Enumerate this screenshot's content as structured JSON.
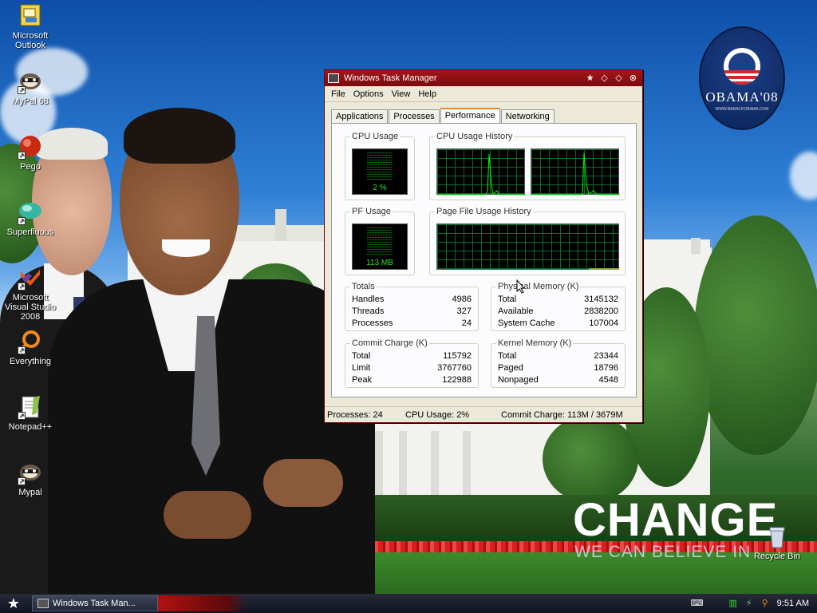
{
  "desktop": {
    "icons": [
      {
        "label": "Microsoft Outlook",
        "icon": "outlook-icon"
      },
      {
        "label": "MyPal 68",
        "icon": "mypal-icon"
      },
      {
        "label": "Pego",
        "icon": "pego-icon"
      },
      {
        "label": "Superfluous",
        "icon": "superfluous-icon"
      },
      {
        "label": "Microsoft Visual Studio 2008",
        "icon": "visual-studio-icon"
      },
      {
        "label": "Everything",
        "icon": "everything-icon"
      },
      {
        "label": "Notepad++",
        "icon": "notepadpp-icon"
      },
      {
        "label": "Mypal",
        "icon": "mypal-icon"
      },
      {
        "label": "Recycle Bin",
        "icon": "recycle-bin-icon"
      }
    ],
    "wallpaper": {
      "logo_text": "OBAMA'08",
      "logo_sub": "WWW.BARACKOBAMA.COM",
      "headline": "CHANGE",
      "subline": "WE CAN BELIEVE IN"
    }
  },
  "window": {
    "title": "Windows Task Manager",
    "menu": [
      "File",
      "Options",
      "View",
      "Help"
    ],
    "tabs": [
      "Applications",
      "Processes",
      "Performance",
      "Networking"
    ],
    "active_tab": "Performance",
    "groups": {
      "cpu_usage": {
        "title": "CPU Usage",
        "value": "2 %",
        "percent": 2
      },
      "cpu_history": {
        "title": "CPU Usage History"
      },
      "pf_usage": {
        "title": "PF Usage",
        "value": "113 MB"
      },
      "pf_history": {
        "title": "Page File Usage History"
      },
      "totals": {
        "title": "Totals",
        "rows": [
          {
            "label": "Handles",
            "value": "4986"
          },
          {
            "label": "Threads",
            "value": "327"
          },
          {
            "label": "Processes",
            "value": "24"
          }
        ]
      },
      "physical": {
        "title": "Physical Memory (K)",
        "rows": [
          {
            "label": "Total",
            "value": "3145132"
          },
          {
            "label": "Available",
            "value": "2838200"
          },
          {
            "label": "System Cache",
            "value": "107004"
          }
        ]
      },
      "commit": {
        "title": "Commit Charge (K)",
        "rows": [
          {
            "label": "Total",
            "value": "115792"
          },
          {
            "label": "Limit",
            "value": "3767760"
          },
          {
            "label": "Peak",
            "value": "122988"
          }
        ]
      },
      "kernel": {
        "title": "Kernel Memory (K)",
        "rows": [
          {
            "label": "Total",
            "value": "23344"
          },
          {
            "label": "Paged",
            "value": "18796"
          },
          {
            "label": "Nonpaged",
            "value": "4548"
          }
        ]
      }
    },
    "status": {
      "processes": "Processes: 24",
      "cpu": "CPU Usage: 2%",
      "commit": "Commit Charge: 113M / 3679M"
    }
  },
  "taskbar": {
    "task_label": "Windows Task Man...",
    "clock": "9:51 AM"
  },
  "colors": {
    "titlebar": "#a3161a",
    "graph_line": "#00ff00",
    "grid": "#0a6b2a",
    "taskbar": "#101320"
  }
}
